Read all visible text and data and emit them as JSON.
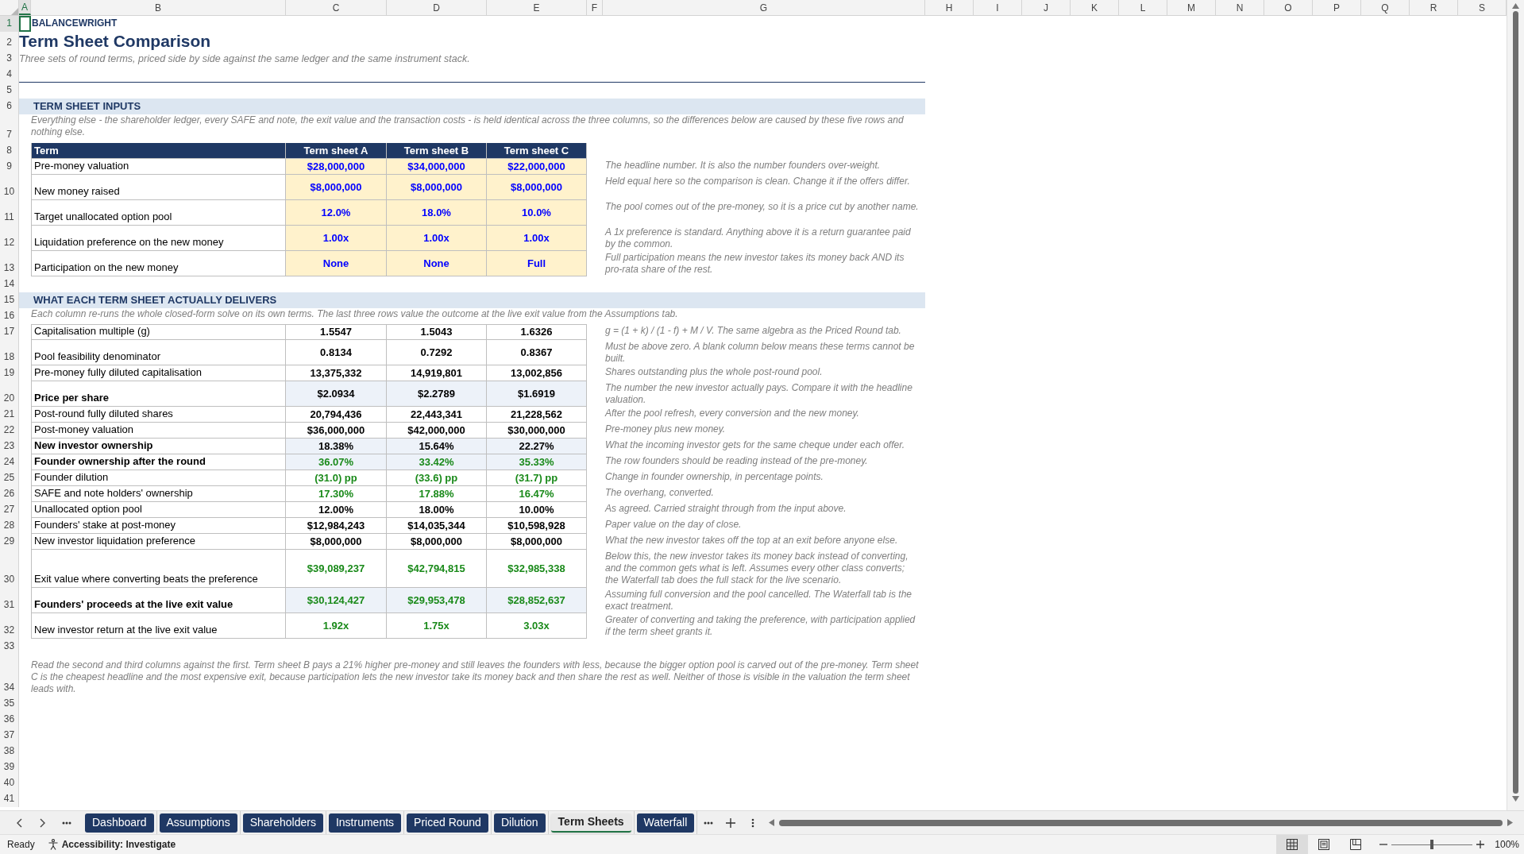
{
  "column_headers": [
    {
      "label": "A",
      "selected": true
    },
    {
      "label": "B",
      "selected": false
    },
    {
      "label": "C",
      "selected": false
    },
    {
      "label": "D",
      "selected": false
    },
    {
      "label": "E",
      "selected": false
    },
    {
      "label": "F",
      "selected": false
    },
    {
      "label": "G",
      "selected": false
    },
    {
      "label": "H",
      "selected": false
    },
    {
      "label": "I",
      "selected": false
    },
    {
      "label": "J",
      "selected": false
    },
    {
      "label": "K",
      "selected": false
    },
    {
      "label": "L",
      "selected": false
    },
    {
      "label": "M",
      "selected": false
    },
    {
      "label": "N",
      "selected": false
    },
    {
      "label": "O",
      "selected": false
    },
    {
      "label": "P",
      "selected": false
    },
    {
      "label": "Q",
      "selected": false
    },
    {
      "label": "R",
      "selected": false
    },
    {
      "label": "S",
      "selected": false
    }
  ],
  "row_numbers": [
    {
      "label": "1",
      "selected": true
    },
    {
      "label": "2",
      "selected": false
    },
    {
      "label": "3",
      "selected": false
    },
    {
      "label": "4",
      "selected": false
    },
    {
      "label": "5",
      "selected": false
    },
    {
      "label": "6",
      "selected": false
    },
    {
      "label": "7",
      "selected": false
    },
    {
      "label": "8",
      "selected": false
    },
    {
      "label": "9",
      "selected": false
    },
    {
      "label": "10",
      "selected": false
    },
    {
      "label": "11",
      "selected": false
    },
    {
      "label": "12",
      "selected": false
    },
    {
      "label": "13",
      "selected": false
    },
    {
      "label": "14",
      "selected": false
    },
    {
      "label": "15",
      "selected": false
    },
    {
      "label": "16",
      "selected": false
    },
    {
      "label": "17",
      "selected": false
    },
    {
      "label": "18",
      "selected": false
    },
    {
      "label": "19",
      "selected": false
    },
    {
      "label": "20",
      "selected": false
    },
    {
      "label": "21",
      "selected": false
    },
    {
      "label": "22",
      "selected": false
    },
    {
      "label": "23",
      "selected": false
    },
    {
      "label": "24",
      "selected": false
    },
    {
      "label": "25",
      "selected": false
    },
    {
      "label": "26",
      "selected": false
    },
    {
      "label": "27",
      "selected": false
    },
    {
      "label": "28",
      "selected": false
    },
    {
      "label": "29",
      "selected": false
    },
    {
      "label": "30",
      "selected": false
    },
    {
      "label": "31",
      "selected": false
    },
    {
      "label": "32",
      "selected": false
    },
    {
      "label": "33",
      "selected": false
    },
    {
      "label": "34",
      "selected": false
    },
    {
      "label": "35",
      "selected": false
    },
    {
      "label": "36",
      "selected": false
    },
    {
      "label": "37",
      "selected": false
    },
    {
      "label": "38",
      "selected": false
    },
    {
      "label": "39",
      "selected": false
    },
    {
      "label": "40",
      "selected": false
    },
    {
      "label": "41",
      "selected": false
    }
  ],
  "brand": "BALANCEWRIGHT",
  "title": "Term Sheet Comparison",
  "subtitle": "Three sets of round terms, priced side by side against the same ledger and the same instrument stack.",
  "inputs": {
    "heading": "TERM SHEET INPUTS",
    "note": "Everything else - the shareholder ledger, every SAFE and note, the exit value and the transaction costs - is held identical across the three columns, so the differences below are caused by these five rows and nothing else.",
    "columns": [
      "Term",
      "Term sheet A",
      "Term sheet B",
      "Term sheet C"
    ],
    "rows": [
      {
        "label": "Pre-money valuation",
        "values": [
          "$28,000,000",
          "$34,000,000",
          "$22,000,000"
        ],
        "comment": "The headline number. It is also the number founders over-weight."
      },
      {
        "label": "New money raised",
        "values": [
          "$8,000,000",
          "$8,000,000",
          "$8,000,000"
        ],
        "comment": "Held equal here so the comparison is clean. Change it if the offers differ."
      },
      {
        "label": "Target unallocated option pool",
        "values": [
          "12.0%",
          "18.0%",
          "10.0%"
        ],
        "comment": "The pool comes out of the pre-money, so it is a price cut by another name."
      },
      {
        "label": "Liquidation preference on the new money",
        "values": [
          "1.00x",
          "1.00x",
          "1.00x"
        ],
        "comment": "A 1x preference is standard. Anything above it is a return guarantee paid by the common."
      },
      {
        "label": "Participation on the new money",
        "values": [
          "None",
          "None",
          "Full"
        ],
        "comment": "Full participation means the new investor takes its money back AND its pro-rata share of the rest."
      }
    ]
  },
  "outputs": {
    "heading": "WHAT EACH TERM SHEET ACTUALLY DELIVERS",
    "note": "Each column re-runs the whole closed-form solve on its own terms. The last three rows value the outcome at the live exit value from the Assumptions tab.",
    "rows": [
      {
        "label": "Capitalisation multiple (g)",
        "bold": false,
        "shaded": false,
        "color": "#000000",
        "values": [
          "1.5547",
          "1.5043",
          "1.6326"
        ],
        "comment": "g = (1 + k) / (1 - f) + M / V. The same algebra as the Priced Round tab."
      },
      {
        "label": "Pool feasibility denominator",
        "bold": false,
        "shaded": false,
        "color": "#000000",
        "values": [
          "0.8134",
          "0.7292",
          "0.8367"
        ],
        "comment": "Must be above zero. A blank column below means these terms cannot be built."
      },
      {
        "label": "Pre-money fully diluted capitalisation",
        "bold": false,
        "shaded": false,
        "color": "#000000",
        "values": [
          "13,375,332",
          "14,919,801",
          "13,002,856"
        ],
        "comment": "Shares outstanding plus the whole post-round pool."
      },
      {
        "label": "Price per share",
        "bold": true,
        "shaded": true,
        "color": "#000000",
        "values": [
          "$2.0934",
          "$2.2789",
          "$1.6919"
        ],
        "comment": "The number the new investor actually pays. Compare it with the headline valuation."
      },
      {
        "label": "Post-round fully diluted shares",
        "bold": false,
        "shaded": false,
        "color": "#000000",
        "values": [
          "20,794,436",
          "22,443,341",
          "21,228,562"
        ],
        "comment": "After the pool refresh, every conversion and the new money."
      },
      {
        "label": "Post-money valuation",
        "bold": false,
        "shaded": false,
        "color": "#000000",
        "values": [
          "$36,000,000",
          "$42,000,000",
          "$30,000,000"
        ],
        "comment": "Pre-money plus new money."
      },
      {
        "label": "New investor ownership",
        "bold": true,
        "shaded": true,
        "color": "#000000",
        "values": [
          "18.38%",
          "15.64%",
          "22.27%"
        ],
        "comment": "What the incoming investor gets for the same cheque under each offer."
      },
      {
        "label": "Founder ownership after the round",
        "bold": true,
        "shaded": true,
        "color": "#1a8a1a",
        "values": [
          "36.07%",
          "33.42%",
          "35.33%"
        ],
        "comment": "The row founders should be reading instead of the pre-money."
      },
      {
        "label": "Founder dilution",
        "bold": false,
        "shaded": false,
        "color": "#1a8a1a",
        "values": [
          "(31.0) pp",
          "(33.6) pp",
          "(31.7) pp"
        ],
        "comment": "Change in founder ownership, in percentage points."
      },
      {
        "label": "SAFE and note holders' ownership",
        "bold": false,
        "shaded": false,
        "color": "#1a8a1a",
        "values": [
          "17.30%",
          "17.88%",
          "16.47%"
        ],
        "comment": "The overhang, converted."
      },
      {
        "label": "Unallocated option pool",
        "bold": false,
        "shaded": false,
        "color": "#000000",
        "values": [
          "12.00%",
          "18.00%",
          "10.00%"
        ],
        "comment": "As agreed. Carried straight through from the input above."
      },
      {
        "label": "Founders' stake at post-money",
        "bold": false,
        "shaded": false,
        "color": "#000000",
        "values": [
          "$12,984,243",
          "$14,035,344",
          "$10,598,928"
        ],
        "comment": "Paper value on the day of close."
      },
      {
        "label": "New investor liquidation preference",
        "bold": false,
        "shaded": false,
        "color": "#000000",
        "values": [
          "$8,000,000",
          "$8,000,000",
          "$8,000,000"
        ],
        "comment": "What the new investor takes off the top at an exit before anyone else."
      },
      {
        "label": "Exit value where converting beats the preference",
        "bold": false,
        "shaded": false,
        "color": "#1a8a1a",
        "values": [
          "$39,089,237",
          "$42,794,815",
          "$32,985,338"
        ],
        "comment": "Below this, the new investor takes its money back instead of converting, and the common gets what is left. Assumes every other class converts; the Waterfall tab does the full stack for the live scenario."
      },
      {
        "label": "Founders' proceeds at the live exit value",
        "bold": true,
        "shaded": true,
        "color": "#1a8a1a",
        "values": [
          "$30,124,427",
          "$29,953,478",
          "$28,852,637"
        ],
        "comment": "Assuming full conversion and the pool cancelled. The Waterfall tab is the exact treatment."
      },
      {
        "label": "New investor return at the live exit value",
        "bold": false,
        "shaded": false,
        "color": "#1a8a1a",
        "values": [
          "1.92x",
          "1.75x",
          "3.03x"
        ],
        "comment": "Greater of converting and taking the preference, with participation applied if the term sheet grants it."
      }
    ]
  },
  "footnote": "Read the second and third columns against the first. Term sheet B pays a 21% higher pre-money and still leaves the founders with less, because the bigger option pool is carved out of the pre-money. Term sheet C is the cheapest headline and the most expensive exit, because participation lets the new investor take its money back and then share the rest as well. Neither of those is visible in the valuation the term sheet leads with.",
  "sheet_tabs": [
    {
      "label": "Dashboard",
      "selected": false
    },
    {
      "label": "Assumptions",
      "selected": false
    },
    {
      "label": "Shareholders",
      "selected": false
    },
    {
      "label": "Instruments",
      "selected": false
    },
    {
      "label": "Priced Round",
      "selected": false
    },
    {
      "label": "Dilution",
      "selected": false
    },
    {
      "label": "Term Sheets",
      "selected": true
    },
    {
      "label": "Waterfall",
      "selected": false
    }
  ],
  "status_bar": {
    "mode": "Ready",
    "accessibility": "Accessibility: Investigate",
    "view_modes": [
      {
        "kind": "normal",
        "selected": true
      },
      {
        "kind": "page_layout",
        "selected": false
      },
      {
        "kind": "page_break",
        "selected": false
      }
    ],
    "zoom_slider": {
      "level": 0.5
    },
    "zoom": "100%"
  }
}
